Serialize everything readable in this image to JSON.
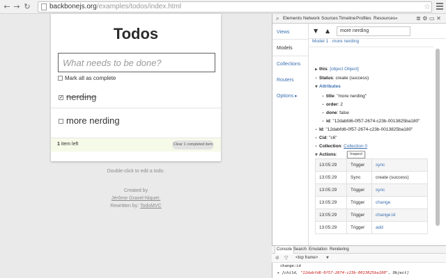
{
  "browser": {
    "url_host": "backbonejs.org",
    "url_path": "/examples/todos/index.html"
  },
  "app": {
    "title": "Todos",
    "new_todo_placeholder": "What needs to be done?",
    "mark_all_label": "Mark all as complete",
    "todos": [
      {
        "title": "nerding",
        "done": true
      },
      {
        "title": "more nerding",
        "done": false
      }
    ],
    "footer": {
      "count": "1",
      "count_suffix": "item left",
      "clear_label": "Clear 1 completed item"
    },
    "info": {
      "edit_hint": "Double-click to edit a todo.",
      "created_by": "Created by",
      "author": "Jérôme Gravel-Niquet.",
      "rewritten_by": "Rewritten by:",
      "rewritten_link": "TodoMVC"
    }
  },
  "devtools": {
    "tabs": [
      "Elements",
      "Network",
      "Sources",
      "Timeline",
      "Profiles",
      "Resources"
    ],
    "tabs_more": "»",
    "sidebar": [
      "Views",
      "Models",
      "Collections",
      "Routers",
      "Options ▸"
    ],
    "filter_value": "more nerding",
    "model_header": "Model 1 · more nerding",
    "tree": {
      "this_key": "this",
      "this_val": "[object Object]",
      "status_key": "Status",
      "status_val": "create (success)",
      "attributes_key": "Attributes",
      "title_key": "title",
      "title_val": "\"more nerding\"",
      "order_key": "order",
      "order_val": "2",
      "done_key": "done",
      "done_val": "false",
      "attr_id_key": "id",
      "attr_id_val": "\"12dabfd6-0f57-2674-c23b-0013825ba180\"",
      "id_key": "Id",
      "id_val": "\"12dabfd6-0f57-2674-c23b-0013825ba180\"",
      "cid_key": "Cid",
      "cid_val": "\"c6\"",
      "collection_key": "Collection",
      "collection_val": "Collection 0",
      "actions_key": "Actions",
      "inspect_tip": "Inspect"
    },
    "actions": [
      {
        "time": "13:05:29",
        "type": "Trigger",
        "name": "sync",
        "link": true
      },
      {
        "time": "13:05:29",
        "type": "Sync",
        "name": "create (success)",
        "link": false
      },
      {
        "time": "13:05:29",
        "type": "Trigger",
        "name": "sync",
        "link": true
      },
      {
        "time": "13:05:29",
        "type": "Trigger",
        "name": "change",
        "link": true
      },
      {
        "time": "13:05:29",
        "type": "Trigger",
        "name": "change:id",
        "link": true
      },
      {
        "time": "13:05:29",
        "type": "Trigger",
        "name": "add",
        "link": true
      }
    ],
    "console_tabs": [
      "Console",
      "Search",
      "Emulation",
      "Rendering"
    ],
    "console_frame": "<top frame>",
    "console_lines": {
      "event": "change:id",
      "prefix": "[child,",
      "string": "\"12dabfd6-0f57-2674-c23b-0013825ba180\"",
      "suffix": ", Object]"
    }
  }
}
